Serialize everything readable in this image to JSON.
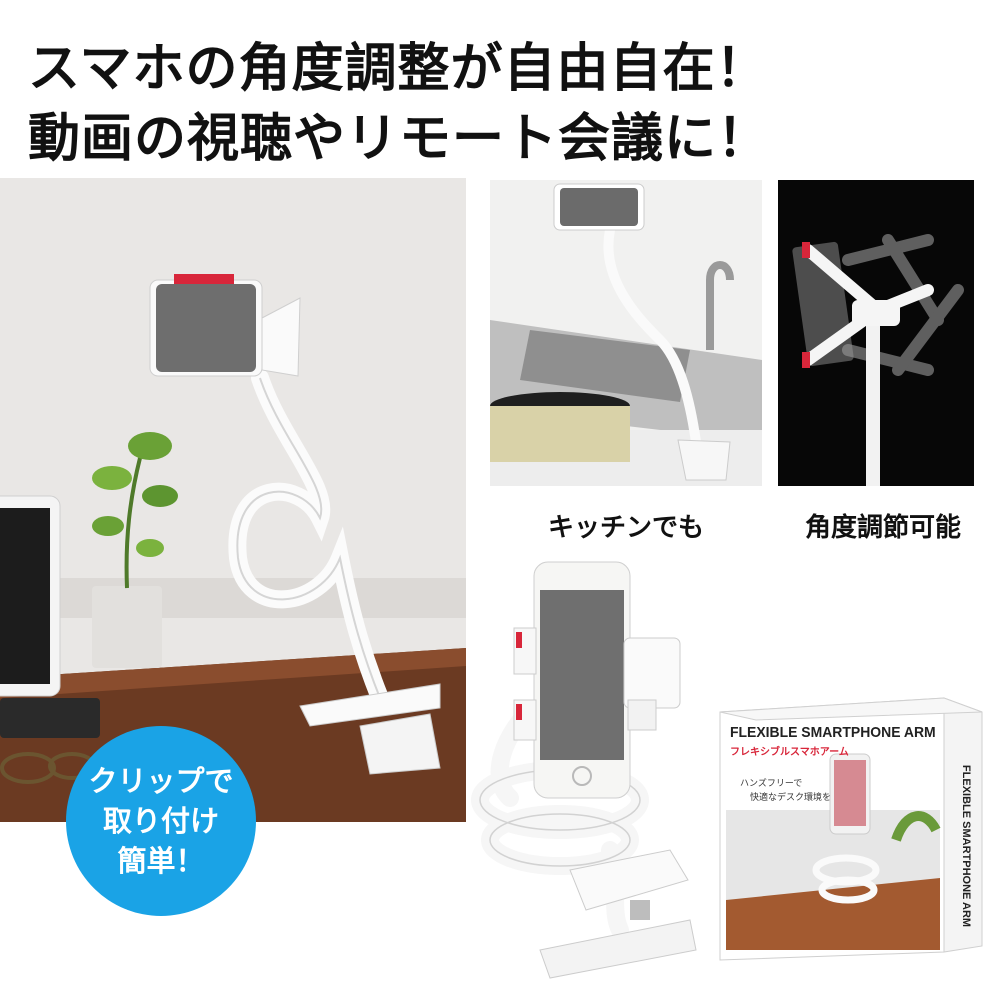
{
  "headline": {
    "line1": "スマホの角度調整が自由自在！",
    "line2": "動画の視聴やリモート会議に！"
  },
  "badge": {
    "line1": "クリップで",
    "line2": "取り付け",
    "line3": "簡単！"
  },
  "captions": {
    "kitchen": "キッチンでも",
    "angle": "角度調節可能"
  },
  "package": {
    "title_en": "FLEXIBLE SMARTPHONE ARM",
    "title_jp": "フレキシブルスマホアーム",
    "tagline1": "ハンズフリーで",
    "tagline2": "快適なデスク環境を",
    "side_text": "FLEXIBLE SMARTPHONE ARM"
  },
  "colors": {
    "badge": "#1aa3e6",
    "accent_red": "#d8263a",
    "headline": "#111111"
  }
}
